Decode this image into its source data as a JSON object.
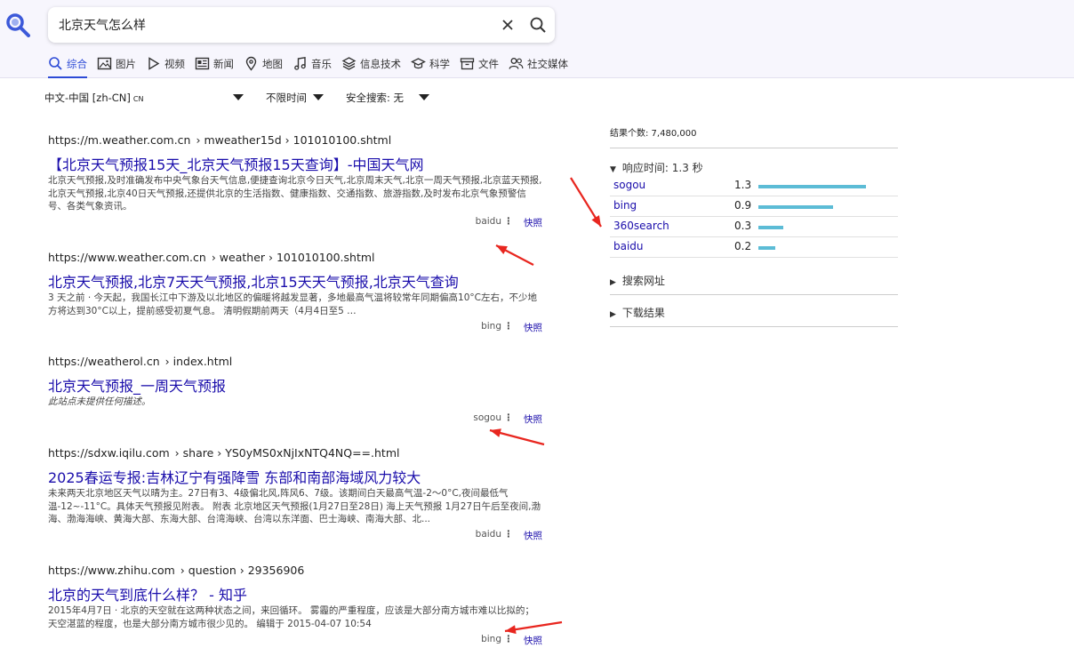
{
  "search": {
    "query": "北京天气怎么样"
  },
  "tabs": [
    {
      "label": "综合",
      "icon": "search-icon",
      "active": true
    },
    {
      "label": "图片",
      "icon": "image-icon"
    },
    {
      "label": "视频",
      "icon": "play-icon"
    },
    {
      "label": "新闻",
      "icon": "newspaper-icon"
    },
    {
      "label": "地图",
      "icon": "map-pin-icon"
    },
    {
      "label": "音乐",
      "icon": "music-icon"
    },
    {
      "label": "信息技术",
      "icon": "layers-icon"
    },
    {
      "label": "科学",
      "icon": "graduation-cap-icon"
    },
    {
      "label": "文件",
      "icon": "archive-icon"
    },
    {
      "label": "社交媒体",
      "icon": "people-icon"
    }
  ],
  "filters": {
    "language": "中文-中国 [zh-CN]",
    "language_code": "CN",
    "time": "不限时间",
    "safe_search": "安全搜索: 无"
  },
  "results": [
    {
      "host": "https://m.weather.com.cn",
      "path": "› mweather15d › 101010100.shtml",
      "title": "【北京天气预报15天_北京天气预报15天查询】-中国天气网",
      "snippet": "北京天气预报,及时准确发布中央气象台天气信息,便捷查询北京今日天气,北京周末天气,北京一周天气预报,北京蓝天预报,北京天气预报,北京40日天气预报,还提供北京的生活指数、健康指数、交通指数、旅游指数,及时发布北京气象预警信号、各类气象资讯。",
      "engine": "baidu",
      "cached": "快照"
    },
    {
      "host": "https://www.weather.com.cn",
      "path": "› weather › 101010100.shtml",
      "title": "北京天气预报,北京7天天气预报,北京15天天气预报,北京天气查询",
      "snippet": "3 天之前 · 今天起，我国长江中下游及以北地区的偏暖将越发显著，多地最高气温将较常年同期偏高10°C左右，不少地方将达到30°C以上，提前感受初夏气息。 清明假期前两天（4月4日至5 …",
      "engine": "bing",
      "cached": "快照"
    },
    {
      "host": "https://weatherol.cn",
      "path": "› index.html",
      "title": "北京天气预报_一周天气预报",
      "snippet": "此站点未提供任何描述。",
      "engine": "sogou",
      "cached": "快照"
    },
    {
      "host": "https://sdxw.iqilu.com",
      "path": "› share › YS0yMS0xNjIxNTQ4NQ==.html",
      "title": "2025春运专报:吉林辽宁有强降雪 东部和南部海域风力较大",
      "snippet": "未来两天北京地区天气以晴为主。27日有3、4级偏北风,阵风6、7级。该期间白天最高气温-2～0°C,夜间最低气温-12~-11°C。具体天气预报见附表。 附表 北京地区天气预报(1月27日至28日) 海上天气预报 1月27日午后至夜间,渤海、渤海海峡、黄海大部、东海大部、台湾海峡、台湾以东洋面、巴士海峡、南海大部、北...",
      "engine": "baidu",
      "cached": "快照"
    },
    {
      "host": "https://www.zhihu.com",
      "path": "› question › 29356906",
      "title": "北京的天气到底什么样？ - 知乎",
      "snippet": "2015年4月7日 · 北京的天空就在这两种状态之间，来回循环。 雾霾的严重程度，应该是大部分南方城市难以比拟的；天空湛蓝的程度，也是大部分南方城市很少见的。 编辑于 2015-04-07 10:54",
      "engine": "bing",
      "cached": "快照"
    }
  ],
  "sidebar": {
    "count": "结果个数: 7,480,000",
    "response_time": "响应时间: 1.3 秒",
    "engines": [
      {
        "name": "sogou",
        "time": "1.3",
        "value": 1.3
      },
      {
        "name": "bing",
        "time": "0.9",
        "value": 0.9
      },
      {
        "name": "360search",
        "time": "0.3",
        "value": 0.3
      },
      {
        "name": "baidu",
        "time": "0.2",
        "value": 0.2
      }
    ],
    "search_url": "搜索网址",
    "download": "下载结果"
  },
  "colors": {
    "accent": "#2d4bd6",
    "link": "#1a0dab",
    "bar": "#5cbcd6",
    "annotation_arrow": "#e8261f"
  }
}
